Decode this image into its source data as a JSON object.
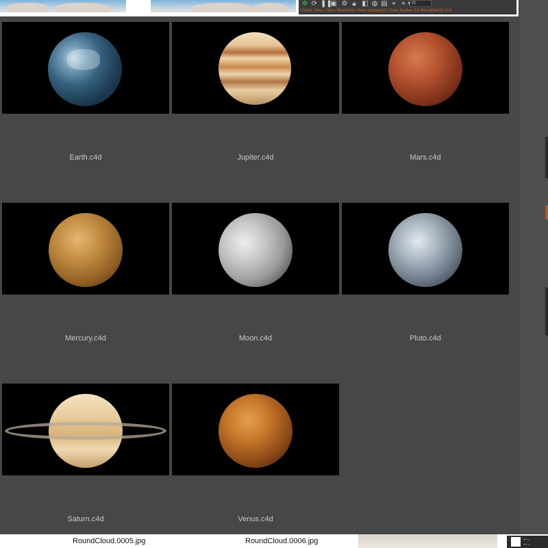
{
  "toolbar": {
    "status_text": "Check 0ms / 0ms  MeshGen 0ms  Update(C) 0ms  Nodes 52  Movable(S) 0.0",
    "field_value": "0L",
    "icons": [
      "refresh-icon",
      "pause-icon",
      "render-icon",
      "gear-icon",
      "lock-icon",
      "folder-icon",
      "bookmark-icon",
      "pin-icon"
    ]
  },
  "browser": {
    "items": [
      {
        "name": "Earth.c4d"
      },
      {
        "name": "Jupiter.c4d"
      },
      {
        "name": "Mars.c4d"
      },
      {
        "name": "Mercury.c4d"
      },
      {
        "name": "Moon.c4d"
      },
      {
        "name": "Pluto.c4d"
      },
      {
        "name": "Saturn.c4d"
      },
      {
        "name": "Venus.c4d"
      }
    ]
  },
  "bottom_files": [
    "RoundCloud.0005.jpg",
    "RoundCloud.0006.jpg"
  ],
  "colors": {
    "panel_bg": "#474747",
    "tile_bg": "#000000",
    "label_text": "#c8c8c8"
  }
}
